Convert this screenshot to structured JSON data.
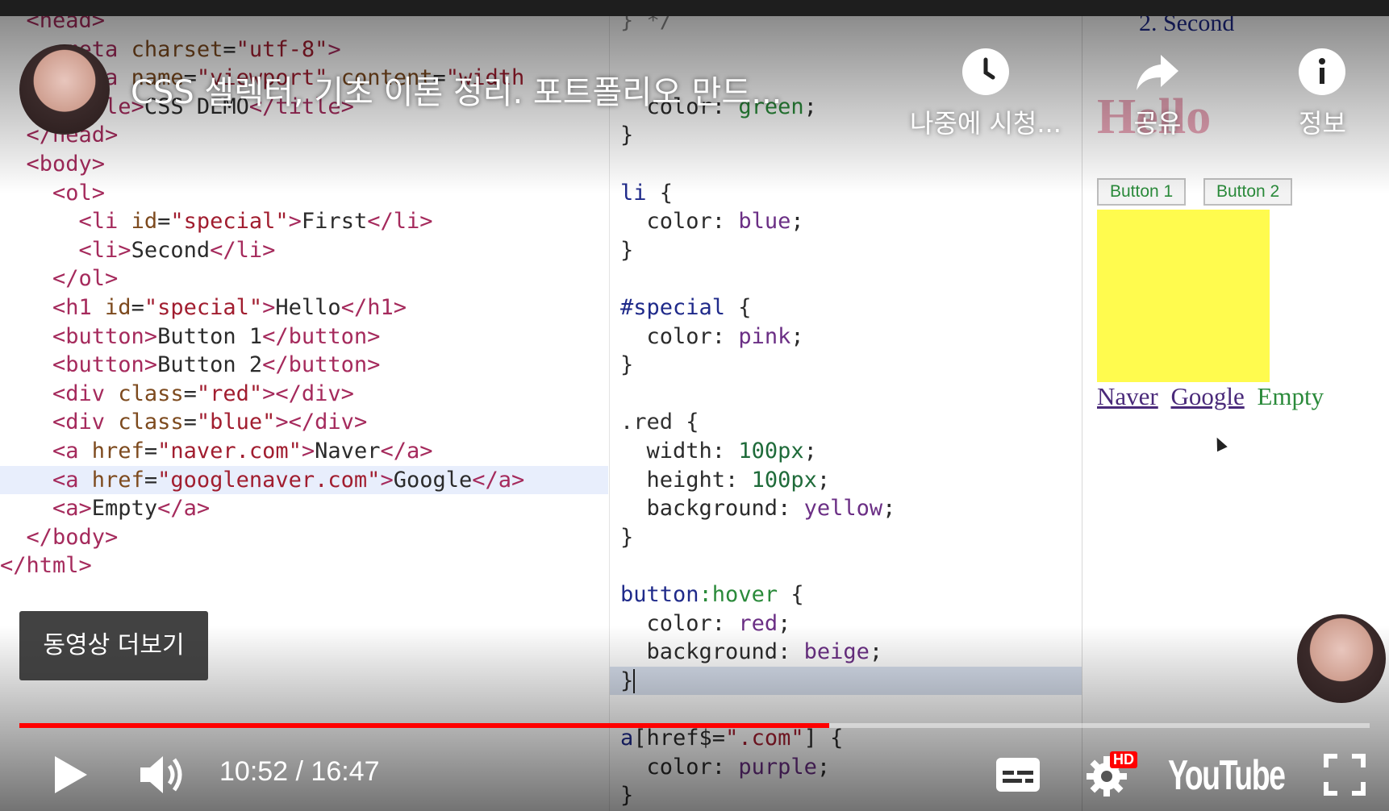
{
  "video": {
    "title": "CSS 셀렉터, 기초 이론 정리. 포트폴리오 만드...",
    "time": "10:52 / 16:47",
    "progress": 0.6,
    "more_videos_label": "동영상 더보기",
    "brand": "YouTube",
    "hd_badge": "HD",
    "actions": {
      "watch_later": "나중에 시청...",
      "share": "공유",
      "info": "정보"
    }
  },
  "html_code": [
    "  <head>",
    "    <meta charset=\"utf-8\">",
    "    <meta name=\"viewport\" content=\"width",
    "    <title>CSS DEMO</title>",
    "  </head>",
    "  <body>",
    "    <ol>",
    "      <li id=\"special\">First</li>",
    "      <li>Second</li>",
    "    </ol>",
    "    <h1 id=\"special\">Hello</h1>",
    "    <button>Button 1</button>",
    "    <button>Button 2</button>",
    "    <div class=\"red\"></div>",
    "    <div class=\"blue\"></div>",
    "    <a href=\"naver.com\">Naver</a>",
    "    <a href=\"googlenaver.com\">Google</a>",
    "    <a>Empty</a>",
    "  </body>",
    "</html>"
  ],
  "css_code": [
    "} */",
    "",
    "",
    "  color: green;",
    "}",
    "",
    "li {",
    "  color: blue;",
    "}",
    "",
    "#special {",
    "  color: pink;",
    "}",
    "",
    ".red {",
    "  width: 100px;",
    "  height: 100px;",
    "  background: yellow;",
    "}",
    "",
    "button:hover {",
    "  color: red;",
    "  background: beige;",
    "}",
    "",
    "a[href$=\".com\"] {",
    "  color: purple;",
    "}"
  ],
  "output": {
    "second_item": "2. Second",
    "heading": "Hello",
    "button1": "Button 1",
    "button2": "Button 2",
    "links": [
      "Naver",
      "Google",
      "Empty"
    ]
  },
  "colors": {
    "progress": "#ff0000",
    "yellow_box": "#fffb4e"
  }
}
